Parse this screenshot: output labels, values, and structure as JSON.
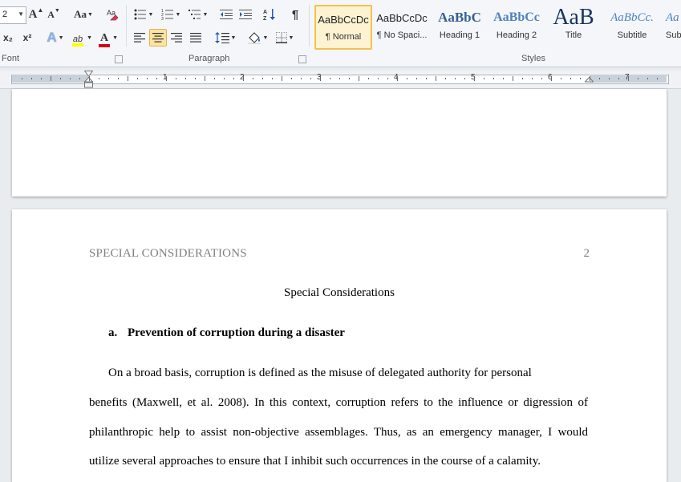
{
  "ribbon": {
    "font": {
      "size_value": "2",
      "group_label": "Font",
      "grow_label": "A",
      "shrink_label": "A",
      "case_label": "Aa",
      "subscript_label": "x₂",
      "superscript_label": "x²",
      "highlight_label": "ab",
      "color_label": "A"
    },
    "paragraph": {
      "group_label": "Paragraph",
      "show_marks_label": "¶"
    },
    "styles": {
      "group_label": "Styles",
      "items": [
        {
          "sample": "AaBbCcDc",
          "name": "¶ Normal"
        },
        {
          "sample": "AaBbCcDc",
          "name": "¶ No Spaci..."
        },
        {
          "sample": "AaBbC",
          "name": "Heading 1"
        },
        {
          "sample": "AaBbCc",
          "name": "Heading 2"
        },
        {
          "sample": "AaB",
          "name": "Title"
        },
        {
          "sample": "AaBbCc.",
          "name": "Subtitle"
        },
        {
          "sample": "Aa",
          "name": "Sub"
        }
      ]
    }
  },
  "ruler": {
    "numbers": [
      "1",
      "2",
      "3",
      "4",
      "5",
      "6",
      "7"
    ]
  },
  "document": {
    "header_left": "SPECIAL CONSIDERATIONS",
    "page_number": "2",
    "title": "Special Considerations",
    "heading_marker": "a.",
    "heading_text": "Prevention of corruption during a disaster",
    "paragraph_lines": [
      "On a broad basis, corruption is defined as the misuse of delegated authority for personal",
      "benefits (Maxwell, et al. 2008). In this context, corruption refers to the influence or digression of",
      "philanthropic help to assist non-objective assemblages. Thus, as an emergency manager, I would",
      "utilize several approaches to ensure that I inhibit such occurrences in the course of a calamity."
    ]
  },
  "colors": {
    "ribbon_bg": "#f4f6fa",
    "active_style_border": "#f1c24f",
    "selected_button": "#fbe3a0",
    "heading_blue": "#365f91",
    "title_blue": "#17365d",
    "header_gray": "#7f7f7f",
    "font_color_red": "#d0021b",
    "highlight_yellow": "#ffff00"
  }
}
